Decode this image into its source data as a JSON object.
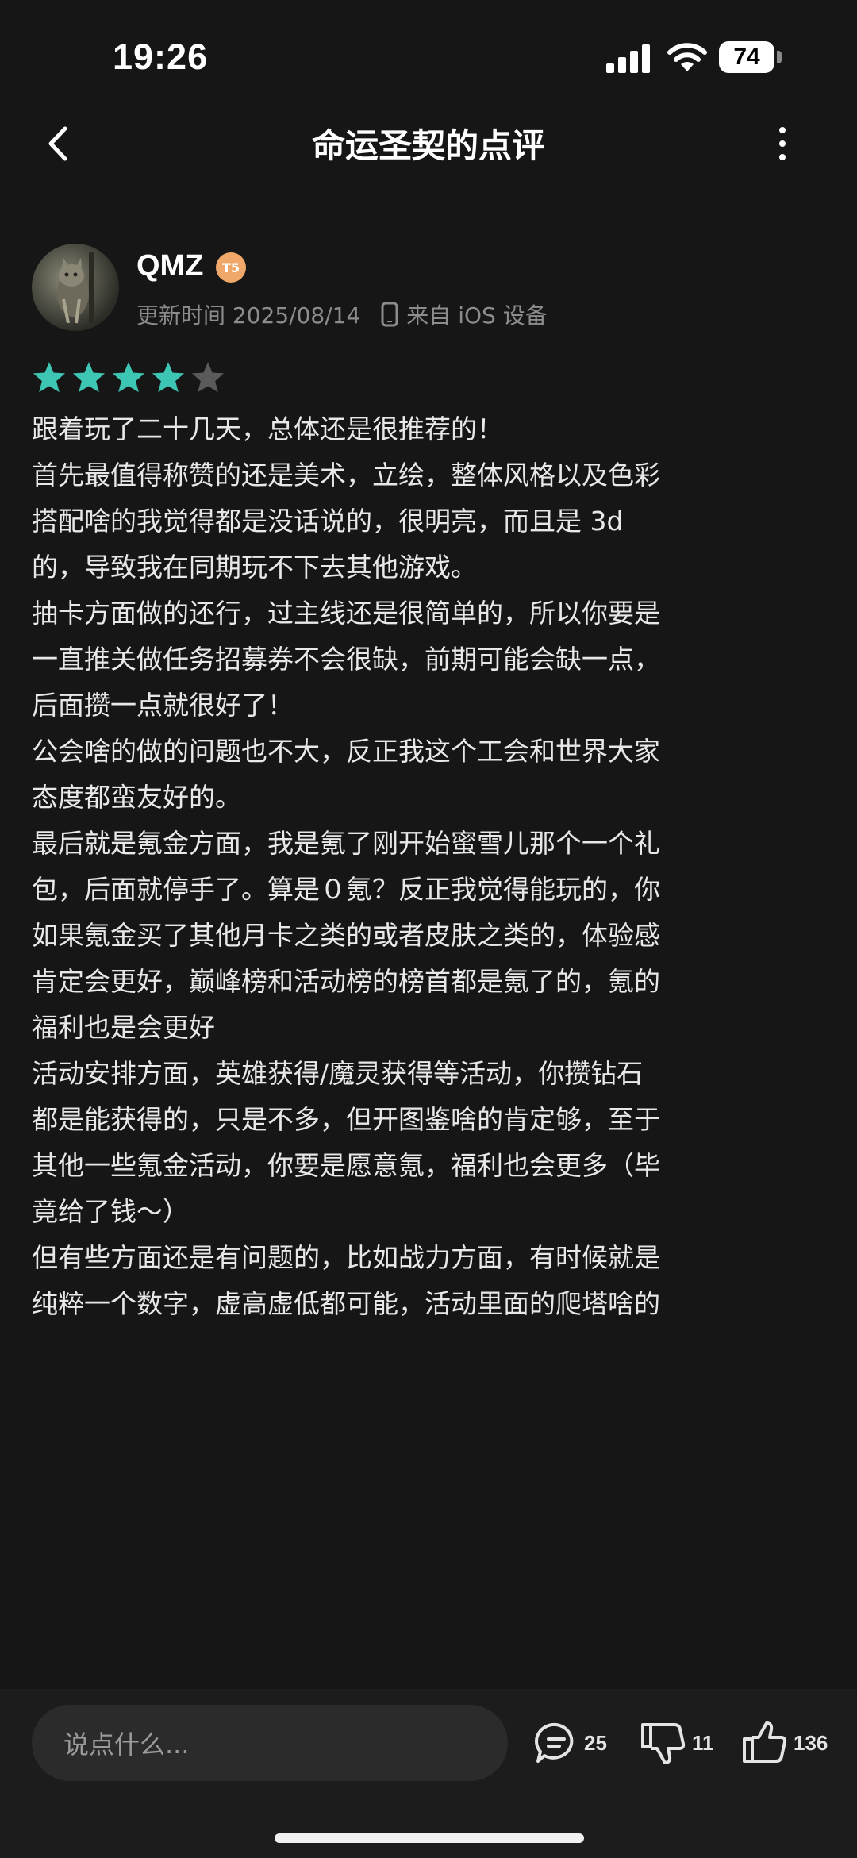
{
  "status_bar": {
    "time": "19:26",
    "battery_level": "74"
  },
  "header": {
    "title": "命运圣契的点评"
  },
  "review": {
    "username": "QMZ",
    "level_badge": "T5",
    "update_time": "更新时间 2025/08/14",
    "device": "来自 iOS 设备",
    "rating": 4,
    "rating_max": 5,
    "star_color": "#3ec6b4",
    "body_lines": [
      "跟着玩了二十几天，总体还是很推荐的！",
      "首先最值得称赞的还是美术，立绘，整体风格以及色彩",
      "搭配啥的我觉得都是没话说的，很明亮，而且是 3d",
      "的，导致我在同期玩不下去其他游戏。",
      "抽卡方面做的还行，过主线还是很简单的，所以你要是",
      "一直推关做任务招募券不会很缺，前期可能会缺一点，",
      "后面攒一点就很好了！",
      "公会啥的做的问题也不大，反正我这个工会和世界大家",
      "态度都蛮友好的。",
      "最后就是氪金方面，我是氪了刚开始蜜雪儿那个一个礼",
      "包，后面就停手了。算是０氪？反正我觉得能玩的，你",
      "如果氪金买了其他月卡之类的或者皮肤之类的，体验感",
      "肯定会更好，巅峰榜和活动榜的榜首都是氪了的，氪的",
      "福利也是会更好",
      "活动安排方面，英雄获得/魔灵获得等活动，你攒钻石",
      "都是能获得的，只是不多，但开图鉴啥的肯定够，至于",
      "其他一些氪金活动，你要是愿意氪，福利也会更多（毕",
      "竟给了钱～）",
      "但有些方面还是有问题的，比如战力方面，有时候就是",
      "纯粹一个数字，虚高虚低都可能，活动里面的爬塔啥的"
    ]
  },
  "bottom_bar": {
    "comment_placeholder": "说点什么...",
    "comment_count": "25",
    "dislike_count": "11",
    "like_count": "136"
  }
}
